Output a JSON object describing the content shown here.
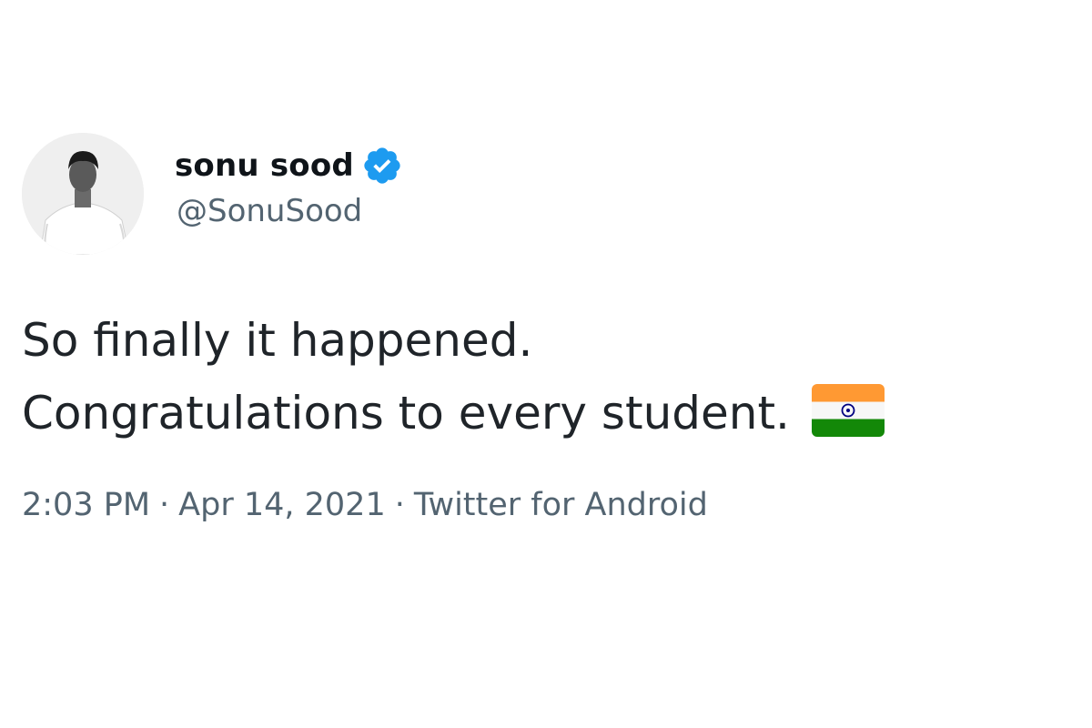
{
  "user": {
    "display_name": "sonu sood",
    "handle": "@SonuSood",
    "verified": true,
    "avatar_icon": "profile-photo"
  },
  "tweet": {
    "lines": [
      "So finally it happened.",
      "Congratulations to every student."
    ],
    "emoji": "india-flag-emoji"
  },
  "meta": {
    "time": "2:03 PM",
    "separator": "·",
    "date": "Apr 14, 2021",
    "source": "Twitter for Android"
  },
  "colors": {
    "verified_badge": "#1d9bf0",
    "secondary_text": "#536471",
    "primary_text": "#0f1419",
    "flag_saffron": "#ff9933",
    "flag_green": "#138808",
    "flag_chakra": "#000080"
  }
}
